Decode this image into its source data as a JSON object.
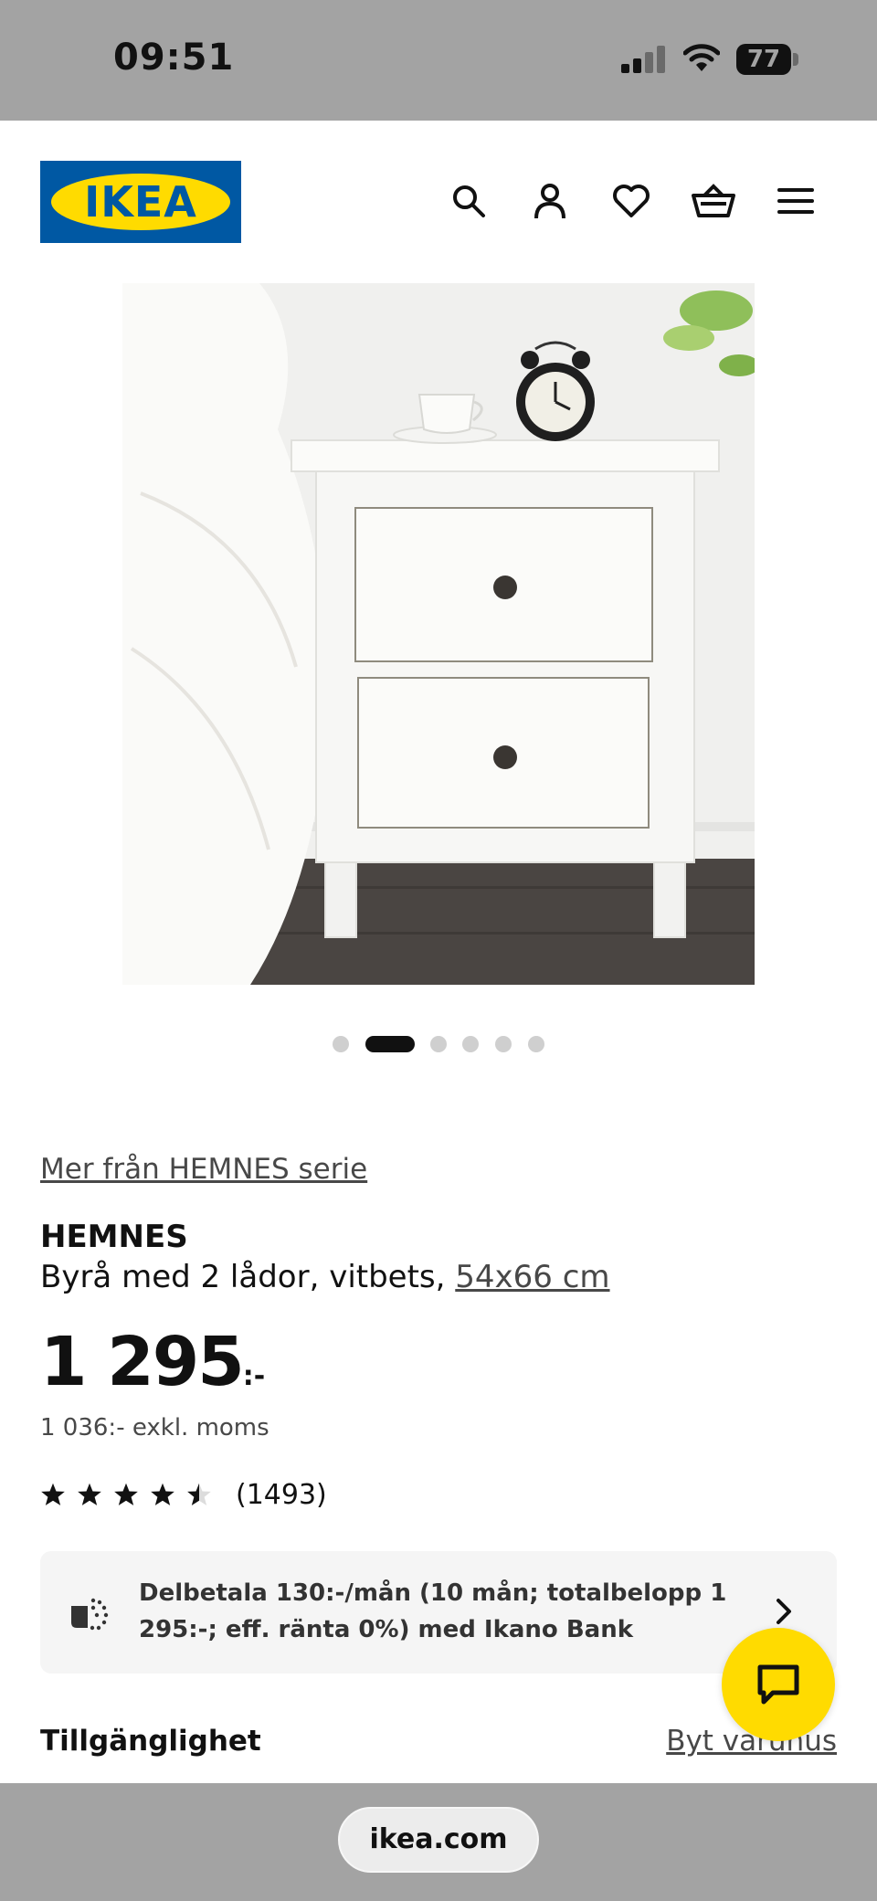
{
  "status_bar": {
    "time": "09:51",
    "battery": "77"
  },
  "header": {
    "logo_text": "IKEA",
    "icons": [
      "search-icon",
      "account-icon",
      "heart-icon",
      "basket-icon",
      "menu-icon"
    ]
  },
  "gallery": {
    "image_label": "HEMNES nightstand",
    "dot_count": 6,
    "active_index": 1
  },
  "product": {
    "series_link": "Mer från HEMNES serie",
    "name": "HEMNES",
    "description": "Byrå med 2 lådor, vitbets, ",
    "size_link": "54x66 cm",
    "price": "1 295",
    "price_suffix": ":-",
    "price_exkl": "1 036:- exkl. moms",
    "rating": 4.5,
    "review_count": "(1493)"
  },
  "finance": {
    "text": "Delbetala 130:-/mån (10 mån; totalbelopp 1 295:-; eff. ränta 0%) med Ikano Bank"
  },
  "availability": {
    "title": "Tillgänglighet",
    "change_store_link": "Byt varuhus"
  },
  "browser": {
    "url": "ikea.com"
  },
  "colors": {
    "ikea_blue": "#0058a3",
    "ikea_yellow": "#ffdb00",
    "chrome_gray": "#a3a3a3"
  }
}
